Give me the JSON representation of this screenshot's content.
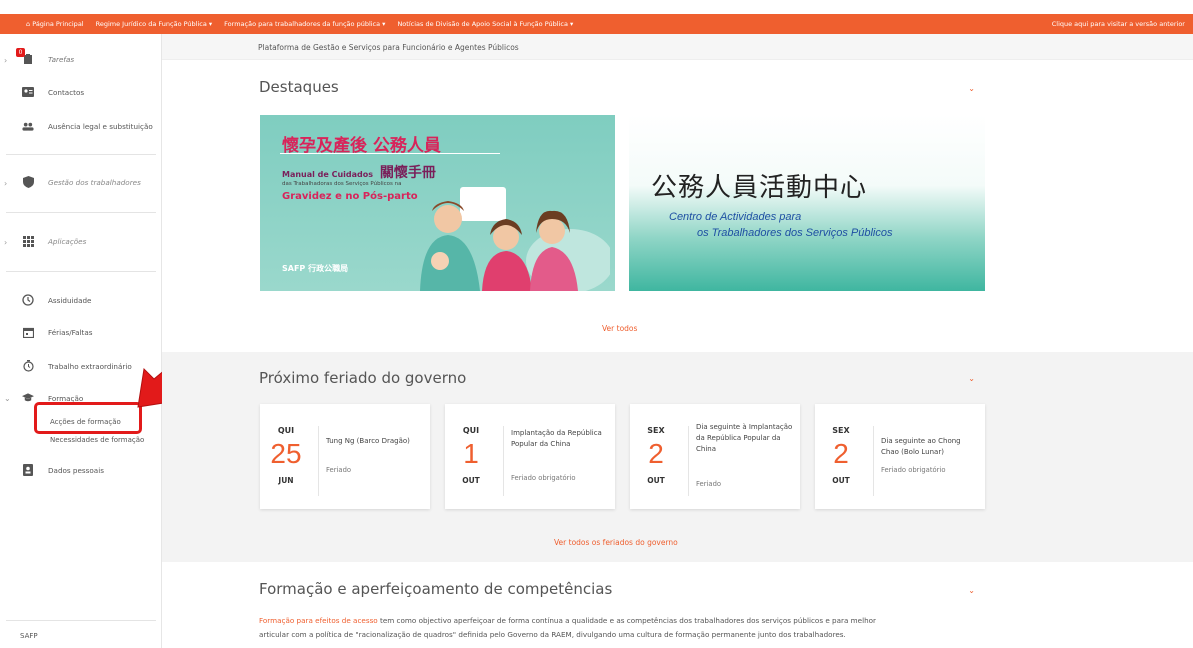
{
  "topnav": {
    "items": [
      "⌂ Página Principal",
      "Regime Jurídico da Função Pública ▾",
      "Formação para trabalhadores da função pública ▾",
      "Notícias de Divisão de Apoio Social à Função Pública ▾"
    ],
    "right_link": "Clique aqui para visitar a versão anterior"
  },
  "sidebar": {
    "tarefas": "Tarefas",
    "tarefas_badge": "0",
    "contactos": "Contactos",
    "ausencia": "Ausência legal e substituição",
    "gestao": "Gestão dos trabalhadores",
    "aplicacoes": "Aplicações",
    "assiduidade": "Assiduidade",
    "ferias": "Férias/Faltas",
    "trabalho": "Trabalho extraordinário",
    "formacao": "Formação",
    "formacao_sub1": "Acções de formação",
    "formacao_sub2": "Necessidades de formação",
    "dados": "Dados pessoais",
    "footer": "SAFP"
  },
  "main": {
    "subheader": "Plataforma de Gestão e Serviços para Funcionário e Agentes Públicos",
    "destaques": {
      "title": "Destaques",
      "banner1": {
        "title_cn": "懷孕及產後 公務人員",
        "line2_pt": "Manual de Cuidados",
        "line2_cn": "關懷手冊",
        "line3": "das Trabalhadoras dos Serviços Públicos na",
        "line4": "Gravidez e no Pós-parto",
        "logo": "SAFP 行政公職局"
      },
      "banner2": {
        "title_cn": "公務人員活動中心",
        "line1": "Centro de Actividades para",
        "line2": "os Trabalhadores dos Serviços Públicos"
      },
      "ver_todos": "Ver todos"
    },
    "feriados": {
      "title": "Próximo feriado do governo",
      "cards": [
        {
          "dow": "QUI",
          "day": "25",
          "month": "JUN",
          "name": "Tung Ng (Barco Dragão)",
          "type": "Feriado"
        },
        {
          "dow": "QUI",
          "day": "1",
          "month": "OUT",
          "name": "Implantação da República Popular da China",
          "type": "Feriado obrigatório"
        },
        {
          "dow": "SEX",
          "day": "2",
          "month": "OUT",
          "name": "Dia seguinte à Implantação da República Popular da China",
          "type": "Feriado"
        },
        {
          "dow": "SEX",
          "day": "2",
          "month": "OUT",
          "name": "Dia seguinte ao Chong Chao (Bolo Lunar)",
          "type": "Feriado obrigatório"
        }
      ],
      "ver_todos": "Ver todos os feriados do governo"
    },
    "formacao": {
      "title": "Formação e aperfeiçoamento de competências",
      "link": "Formação para efeitos de acesso",
      "text1": " tem como objectivo aperfeiçoar de forma contínua a qualidade e as competências dos trabalhadores dos serviços públicos e para melhor",
      "text2": "articular com a política de \"racionalização de quadros\" definida pelo Governo da RAEM, divulgando uma cultura de formação permanente junto dos trabalhadores."
    }
  },
  "colors": {
    "accent": "#ef5f2f",
    "highlight": "#e21a1a"
  }
}
